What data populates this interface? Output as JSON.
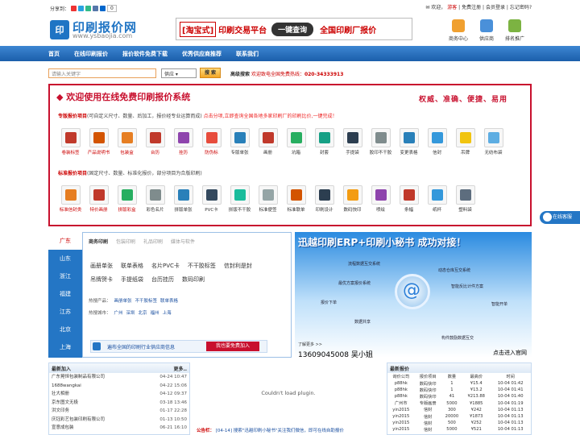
{
  "top": {
    "share_label": "分享到：",
    "share_count": "0",
    "welcome_text": "欢迎，",
    "guest": "游客",
    "links": [
      "免费注册",
      "会员登录",
      "忘记密码?"
    ]
  },
  "logo": {
    "mark": "印",
    "title": "印刷报价网",
    "url": "www.ysbaojia.com"
  },
  "banner": {
    "taobao": "[淘宝式]",
    "platform": "印刷交易平台",
    "button": "一键查询",
    "factory": "全国印刷厂报价"
  },
  "quick_links": [
    "商务中心",
    "供应商",
    "排名推广"
  ],
  "nav": [
    "首页",
    "在线印刷报价",
    "报价软件免费下载",
    "优秀供应商推荐",
    "联系我们"
  ],
  "search": {
    "placeholder": "请输入关键字",
    "select": "供应",
    "button": "搜 索",
    "hot_label": "高级搜索",
    "hotline_label": "欢迎致电全国免费热线：",
    "hotline": "020-34333913"
  },
  "welcome": {
    "title": "◆ 欢迎使用在线免费印刷报价系统",
    "slogan": "权威、准确、便捷、易用",
    "special_label": "专版报价项目",
    "special_desc": "(可自定义尺寸、数量、后加工，报价经专业运算而成)",
    "special_hint": "点击分项,立即查询全国各地多家印刷厂的印刷比价,一键完成！",
    "special_items": [
      {
        "label": "卷装标签",
        "color": "#c0392b",
        "red": true
      },
      {
        "label": "产品说明书",
        "color": "#d35400",
        "red": true
      },
      {
        "label": "包装盒",
        "color": "#e67e22",
        "red": true
      },
      {
        "label": "台历",
        "color": "#c0392b",
        "red": true
      },
      {
        "label": "挂历",
        "color": "#8e44ad",
        "red": true
      },
      {
        "label": "防伪标",
        "color": "#e74c3c",
        "red": true
      },
      {
        "label": "专版单张",
        "color": "#2980b9",
        "red": false
      },
      {
        "label": "画册",
        "color": "#c0392b",
        "red": false
      },
      {
        "label": "坑箱",
        "color": "#27ae60",
        "red": false
      },
      {
        "label": "封套",
        "color": "#16a085",
        "red": false
      },
      {
        "label": "手提袋",
        "color": "#2c3e50",
        "red": false
      },
      {
        "label": "胶印不干胶",
        "color": "#7f8c8d",
        "red": false
      },
      {
        "label": "变更表格",
        "color": "#2980b9",
        "red": false
      },
      {
        "label": "信封",
        "color": "#3498db",
        "red": false
      },
      {
        "label": "吊牌",
        "color": "#f1c40f",
        "red": false
      },
      {
        "label": "无纺布袋",
        "color": "#5dade2",
        "red": false
      }
    ],
    "standard_label": "标准报价项目",
    "standard_desc": "(固定尺寸、数量、标准化报价，部分项目为合版印刷)",
    "standard_items": [
      {
        "label": "标准信封类",
        "color": "#e67e22",
        "red": true
      },
      {
        "label": "特价画册",
        "color": "#c0392b",
        "red": true
      },
      {
        "label": "拼版彩盒",
        "color": "#27ae60",
        "red": true
      },
      {
        "label": "彩色名片",
        "color": "#7f8c8d",
        "red": false
      },
      {
        "label": "拼版单张",
        "color": "#2980b9",
        "red": false
      },
      {
        "label": "PVC卡",
        "color": "#34495e",
        "red": false
      },
      {
        "label": "拼版不干胶",
        "color": "#1abc9c",
        "red": false
      },
      {
        "label": "标准便签",
        "color": "#95a5a6",
        "red": false
      },
      {
        "label": "标准联单",
        "color": "#d35400",
        "red": false
      },
      {
        "label": "印刷设计",
        "color": "#2c3e50",
        "red": false
      },
      {
        "label": "数码快印",
        "color": "#f39c12",
        "red": false
      },
      {
        "label": "喷绘",
        "color": "#8e44ad",
        "red": false
      },
      {
        "label": "条幅",
        "color": "#c0392b",
        "red": false
      },
      {
        "label": "纸杯",
        "color": "#3498db",
        "red": false
      },
      {
        "label": "塑料袋",
        "color": "#5d6d7e",
        "red": false
      }
    ]
  },
  "regions": [
    "广东",
    "山东",
    "浙江",
    "福建",
    "江苏",
    "北京",
    "上海"
  ],
  "biz": {
    "tabs": [
      "商务印刷",
      "包装印刷",
      "礼品印刷",
      "媒体与软件"
    ],
    "links": [
      "画册单张",
      "联单表格",
      "名片PVC卡",
      "不干胶标签",
      "信封利是封",
      "吊牌贺卡",
      "手提纸袋",
      "台历挂历",
      "数码印刷"
    ],
    "hot_products_label": "热搜产品：",
    "hot_products": [
      "画册单张",
      "不干胶标签",
      "联单表格"
    ],
    "hot_cities_label": "热搜城市：",
    "hot_cities": [
      "广州",
      "深圳",
      "北京",
      "福州",
      "上海"
    ],
    "join_text": "遍布全国的印刷行业供应商信息",
    "join_button": "我也要免费加入"
  },
  "erp": {
    "title": "迅越印刷ERP+印刷小秘书 成功对接！",
    "nodes": [
      "流程数据互交系统",
      "动态仓库互交系统",
      "最优方案报价系统",
      "智能反比计件方案",
      "报价下单",
      "智能开单",
      "数据共享",
      "构件鼓励数据互交"
    ],
    "more": "了解更多 >>",
    "phone": "13609045008 吴小姐",
    "go": "点击进入官网"
  },
  "new_join": {
    "title": "最新加入",
    "more": "更多..",
    "rows": [
      {
        "name": "广东晃恒包装制品有限公司",
        "date": "04-24 10:47"
      },
      {
        "name": "1688wangkai",
        "date": "04-22 15:06"
      },
      {
        "name": "壮大相册",
        "date": "04-12 09:37"
      },
      {
        "name": "京东图文无极",
        "date": "03-18 13:46"
      },
      {
        "name": "洪文印务",
        "date": "01-17 22:28"
      },
      {
        "name": "庆钰彩艺包装印刷有限公司",
        "date": "01-13 10:50"
      },
      {
        "name": "宣意成包装",
        "date": "06-21 16:10"
      }
    ]
  },
  "plugin_text": "Couldn't load plugin.",
  "notice": {
    "label": "公告栏：",
    "text": "[04-14] 搜索\"迅越印刷小秘书\"关注我们微信，即可在线自助报价"
  },
  "latest_price": {
    "title": "最新报价",
    "headers": [
      "询价公司",
      "报价项目",
      "数量",
      "最高价",
      "时间"
    ],
    "rows": [
      [
        "p88hk",
        "数码快印",
        "1",
        "¥15.4",
        "10-04 01:42"
      ],
      [
        "p88hk",
        "数码快印",
        "1",
        "¥13.2",
        "10-04 01:41"
      ],
      [
        "p88hk",
        "数码快印",
        "41",
        "¥213.88",
        "10-04 01:40"
      ],
      [
        "广州市",
        "专版画册",
        "5000",
        "¥1885",
        "10-04 01:19"
      ],
      [
        "yin2015",
        "信封",
        "300",
        "¥242",
        "10-04 01:13"
      ],
      [
        "yin2015",
        "信封",
        "20000",
        "¥1873",
        "10-04 01:13"
      ],
      [
        "yin2015",
        "信封",
        "500",
        "¥252",
        "10-04 01:13"
      ],
      [
        "yin2015",
        "信封",
        "5000",
        "¥521",
        "10-04 01:13"
      ]
    ]
  },
  "online_service": "在线客服"
}
